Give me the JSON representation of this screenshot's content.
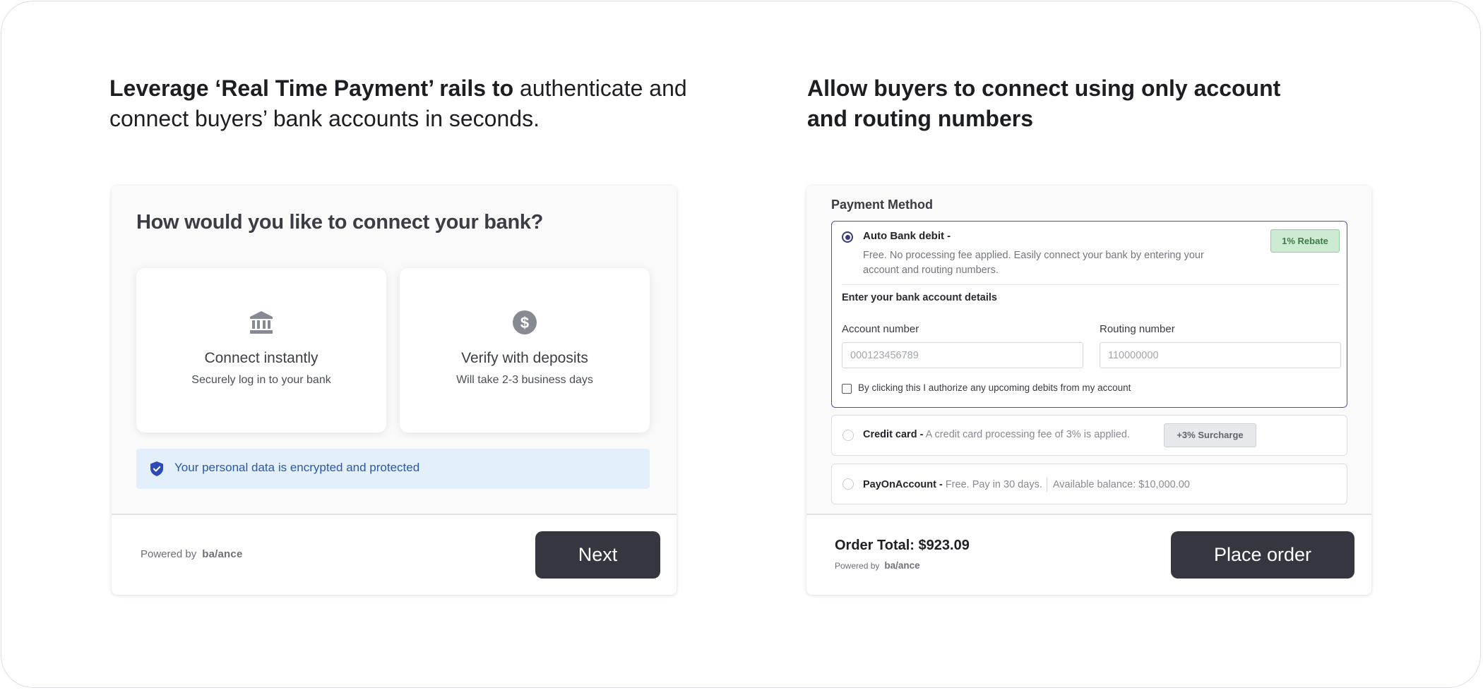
{
  "left": {
    "heading_bold": "Leverage ‘Real Time Payment’ rails to",
    "heading_rest": " authenticate and connect buyers’ bank accounts in seconds.",
    "card": {
      "title": "How would you like to connect your bank?",
      "options": [
        {
          "icon": "bank-icon",
          "title": "Connect instantly",
          "subtitle": "Securely log in to your bank"
        },
        {
          "icon": "dollar-icon",
          "title": "Verify with deposits",
          "subtitle": "Will take 2-3 business days"
        }
      ],
      "secure_icon": "shield-check-icon",
      "secure_text": "Your personal data is encrypted and protected",
      "powered_by": "Powered by",
      "brand": "ba/ance",
      "next_label": "Next"
    }
  },
  "right": {
    "heading": "Allow buyers to connect using only account and routing numbers",
    "card": {
      "title": "Payment Method",
      "auto_bank": {
        "title": "Auto Bank debit -",
        "description": "Free. No processing fee applied. Easily connect your bank by entering your account and routing numbers.",
        "badge": "1% Rebate",
        "section_label": "Enter your bank account details",
        "account_label": "Account number",
        "account_placeholder": "000123456789",
        "routing_label": "Routing number",
        "routing_placeholder": "110000000",
        "authorize_text": "By clicking this I authorize any upcoming debits from my account"
      },
      "credit_card": {
        "title": "Credit card -",
        "description": "A credit card processing fee of 3% is applied.",
        "badge": "+3% Surcharge"
      },
      "pay_on_account": {
        "title": "PayOnAccount -",
        "description": "Free. Pay in 30 days.",
        "balance": "Available balance: $10,000.00"
      },
      "order_total": "Order Total: $923.09",
      "powered_by": "Powered by",
      "brand": "ba/ance",
      "place_order_label": "Place order"
    }
  },
  "colors": {
    "dark_button": "#35363f",
    "accent_blue": "#353b87",
    "secure_bg": "#e3f0fb",
    "rebate_green": "#cdebd2"
  }
}
